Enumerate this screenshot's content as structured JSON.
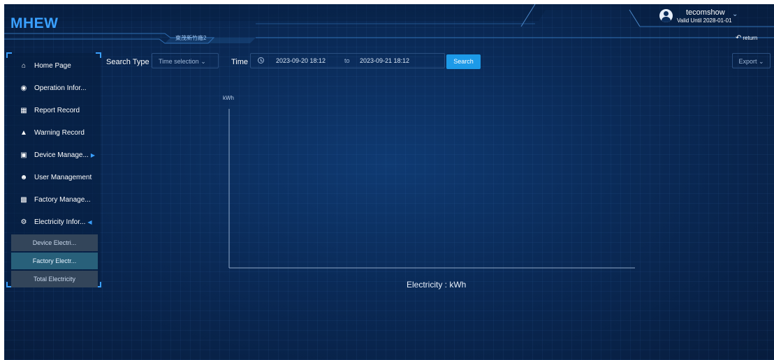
{
  "header": {
    "app_title": "MHEW",
    "factory_name": "東茂新竹廠2",
    "user": {
      "name": "tecomshow",
      "valid_until": "Valid Until 2028-01-01"
    },
    "return_label": "return"
  },
  "sidebar": {
    "items": [
      {
        "label": "Home Page",
        "icon": "home-icon"
      },
      {
        "label": "Operation Infor...",
        "icon": "target-icon"
      },
      {
        "label": "Report Record",
        "icon": "calendar-icon"
      },
      {
        "label": "Warning Record",
        "icon": "bell-icon"
      },
      {
        "label": "Device Manage...",
        "icon": "grid-icon",
        "expanded": false
      },
      {
        "label": "User Management",
        "icon": "users-icon"
      },
      {
        "label": "Factory Manage...",
        "icon": "factory-icon"
      },
      {
        "label": "Electricity Infor...",
        "icon": "gear-icon",
        "expanded": true
      }
    ],
    "sub_items": [
      {
        "label": "Device Electri...",
        "active": false
      },
      {
        "label": "Factory Electr...",
        "active": true
      },
      {
        "label": "Total Electricity",
        "active": false
      }
    ]
  },
  "toolbar": {
    "search_type_label": "Search Type",
    "search_type_value": "Time selection",
    "time_label": "Time",
    "start_time": "2023-09-20 18:12",
    "separator": "to",
    "end_time": "2023-09-21 18:12",
    "search_label": "Search",
    "export_label": "Export"
  },
  "chart_data": {
    "type": "line",
    "ylabel": "kWh",
    "xlabel": "Electricity : kWh",
    "series": []
  },
  "colors": {
    "accent": "#3aa0ff",
    "button": "#1c9ae8",
    "background": "#0a2a57",
    "submenu_active": "#28607a"
  }
}
